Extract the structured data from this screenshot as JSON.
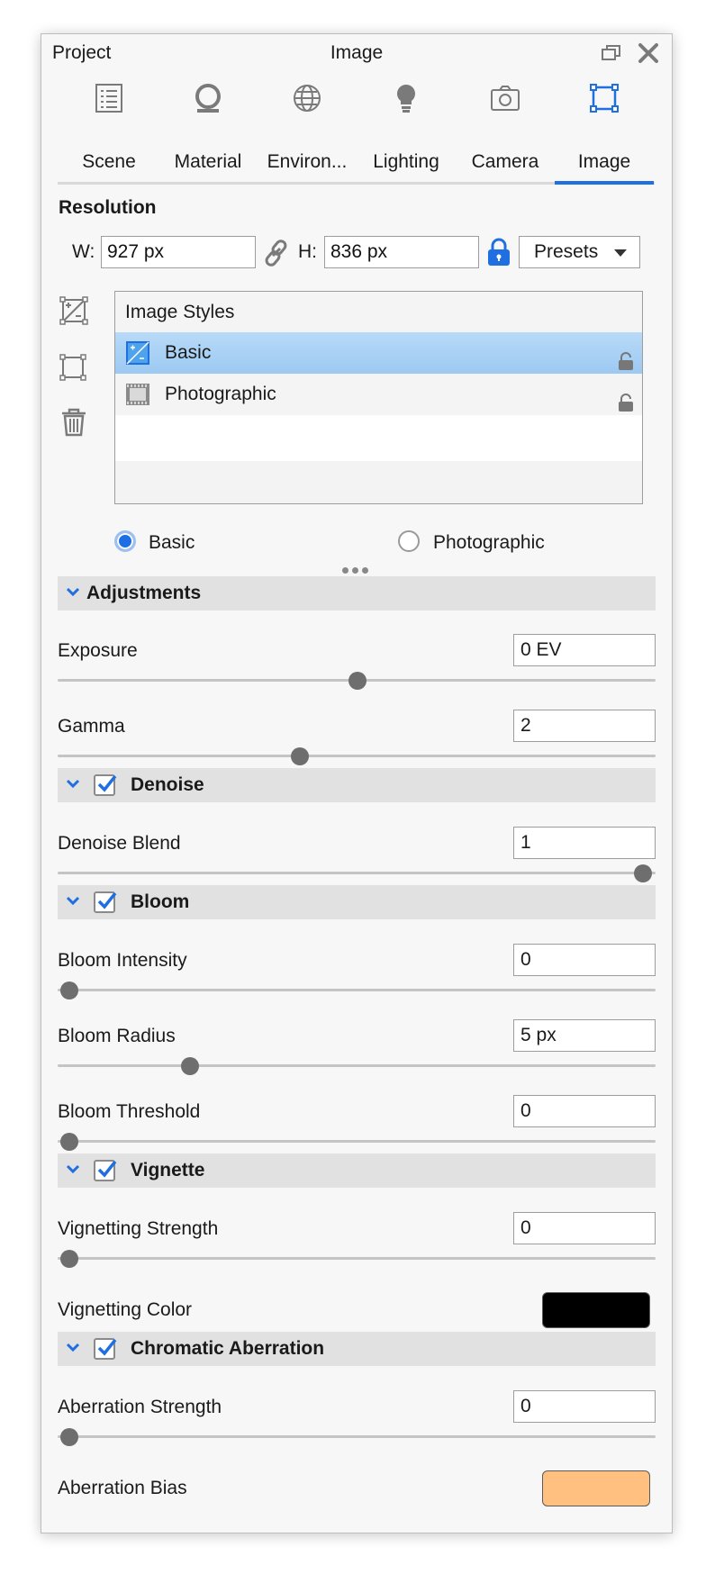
{
  "window": {
    "project_label": "Project",
    "title": "Image"
  },
  "tabs": [
    {
      "label": "Scene",
      "icon": "list-icon"
    },
    {
      "label": "Material",
      "icon": "material-ball-icon"
    },
    {
      "label": "Environ...",
      "icon": "globe-icon"
    },
    {
      "label": "Lighting",
      "icon": "bulb-icon"
    },
    {
      "label": "Camera",
      "icon": "camera-icon"
    },
    {
      "label": "Image",
      "icon": "crop-frame-icon",
      "selected": true
    }
  ],
  "resolution": {
    "title": "Resolution",
    "w_label": "W:",
    "w_value": "927 px",
    "h_label": "H:",
    "h_value": "836 px",
    "presets_label": "Presets",
    "locked": true
  },
  "image_styles": {
    "header": "Image Styles",
    "items": [
      {
        "label": "Basic",
        "selected": true,
        "locked": true
      },
      {
        "label": "Photographic",
        "selected": false,
        "locked": true
      }
    ]
  },
  "mode": {
    "options": [
      "Basic",
      "Photographic"
    ],
    "selected": "Basic"
  },
  "groups": {
    "adjustments": {
      "title": "Adjustments",
      "exposure": {
        "label": "Exposure",
        "value": "0 EV",
        "slider": 0.5
      },
      "gamma": {
        "label": "Gamma",
        "value": "2",
        "slider": 0.4
      }
    },
    "denoise": {
      "title": "Denoise",
      "enabled": true,
      "blend": {
        "label": "Denoise Blend",
        "value": "1",
        "slider": 1.0
      }
    },
    "bloom": {
      "title": "Bloom",
      "enabled": true,
      "intensity": {
        "label": "Bloom Intensity",
        "value": "0",
        "slider": 0.0
      },
      "radius": {
        "label": "Bloom Radius",
        "value": "5 px",
        "slider": 0.22
      },
      "threshold": {
        "label": "Bloom Threshold",
        "value": "0",
        "slider": 0.0
      }
    },
    "vignette": {
      "title": "Vignette",
      "enabled": true,
      "strength": {
        "label": "Vignetting Strength",
        "value": "0",
        "slider": 0.0
      },
      "color": {
        "label": "Vignetting Color",
        "swatch": "#000000"
      }
    },
    "chromatic": {
      "title": "Chromatic Aberration",
      "enabled": true,
      "strength": {
        "label": "Aberration Strength",
        "value": "0",
        "slider": 0.0
      },
      "bias": {
        "label": "Aberration Bias",
        "swatch": "#ffc080"
      }
    }
  },
  "colors": {
    "accent": "#1f6fe0",
    "selection": "#a9d1f5",
    "group_header": "#e1e1e1"
  }
}
